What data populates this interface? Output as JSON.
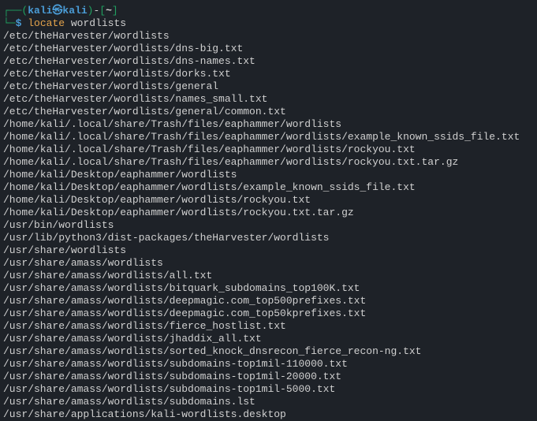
{
  "prompt": {
    "open_paren": "┌──(",
    "user_host": "kali㉿kali",
    "close_paren": ")",
    "dash": "-",
    "open_bracket": "[",
    "path": "~",
    "close_bracket": "]",
    "arm": "└─",
    "dollar": "$",
    "command": "locate",
    "argument": "wordlists"
  },
  "output_lines": [
    "/etc/theHarvester/wordlists",
    "/etc/theHarvester/wordlists/dns-big.txt",
    "/etc/theHarvester/wordlists/dns-names.txt",
    "/etc/theHarvester/wordlists/dorks.txt",
    "/etc/theHarvester/wordlists/general",
    "/etc/theHarvester/wordlists/names_small.txt",
    "/etc/theHarvester/wordlists/general/common.txt",
    "/home/kali/.local/share/Trash/files/eaphammer/wordlists",
    "/home/kali/.local/share/Trash/files/eaphammer/wordlists/example_known_ssids_file.txt",
    "/home/kali/.local/share/Trash/files/eaphammer/wordlists/rockyou.txt",
    "/home/kali/.local/share/Trash/files/eaphammer/wordlists/rockyou.txt.tar.gz",
    "/home/kali/Desktop/eaphammer/wordlists",
    "/home/kali/Desktop/eaphammer/wordlists/example_known_ssids_file.txt",
    "/home/kali/Desktop/eaphammer/wordlists/rockyou.txt",
    "/home/kali/Desktop/eaphammer/wordlists/rockyou.txt.tar.gz",
    "/usr/bin/wordlists",
    "/usr/lib/python3/dist-packages/theHarvester/wordlists",
    "/usr/share/wordlists",
    "/usr/share/amass/wordlists",
    "/usr/share/amass/wordlists/all.txt",
    "/usr/share/amass/wordlists/bitquark_subdomains_top100K.txt",
    "/usr/share/amass/wordlists/deepmagic.com_top500prefixes.txt",
    "/usr/share/amass/wordlists/deepmagic.com_top50kprefixes.txt",
    "/usr/share/amass/wordlists/fierce_hostlist.txt",
    "/usr/share/amass/wordlists/jhaddix_all.txt",
    "/usr/share/amass/wordlists/sorted_knock_dnsrecon_fierce_recon-ng.txt",
    "/usr/share/amass/wordlists/subdomains-top1mil-110000.txt",
    "/usr/share/amass/wordlists/subdomains-top1mil-20000.txt",
    "/usr/share/amass/wordlists/subdomains-top1mil-5000.txt",
    "/usr/share/amass/wordlists/subdomains.lst",
    "/usr/share/applications/kali-wordlists.desktop"
  ]
}
